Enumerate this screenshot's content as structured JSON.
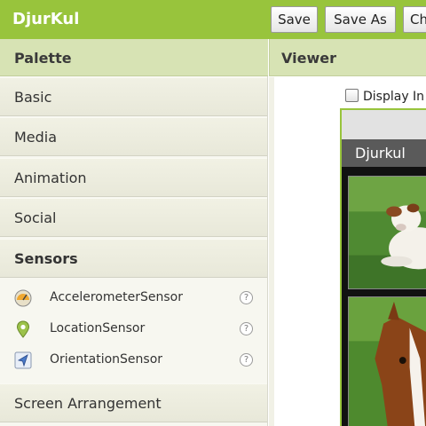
{
  "app": {
    "title": "DjurKul"
  },
  "toolbar": {
    "save_label": "Save",
    "save_as_label": "Save As",
    "checkpoint_label": "Ch"
  },
  "palette": {
    "header": "Palette",
    "categories": {
      "basic": "Basic",
      "media": "Media",
      "animation": "Animation",
      "social": "Social",
      "sensors": "Sensors",
      "screen_arrangement": "Screen Arrangement"
    },
    "sensors": [
      {
        "label": "AccelerometerSensor",
        "icon": "accelerometer-icon",
        "help": "?"
      },
      {
        "label": "LocationSensor",
        "icon": "location-pin-icon",
        "help": "?"
      },
      {
        "label": "OrientationSensor",
        "icon": "orientation-icon",
        "help": "?"
      }
    ]
  },
  "viewer": {
    "header": "Viewer",
    "display_checkbox_label": "Display In",
    "display_checked": false,
    "screen_title": "Djurkul"
  },
  "colors": {
    "accent": "#98c43c",
    "header_bg": "#d7e3b4",
    "phone_titlebar": "#5a5a5a"
  }
}
